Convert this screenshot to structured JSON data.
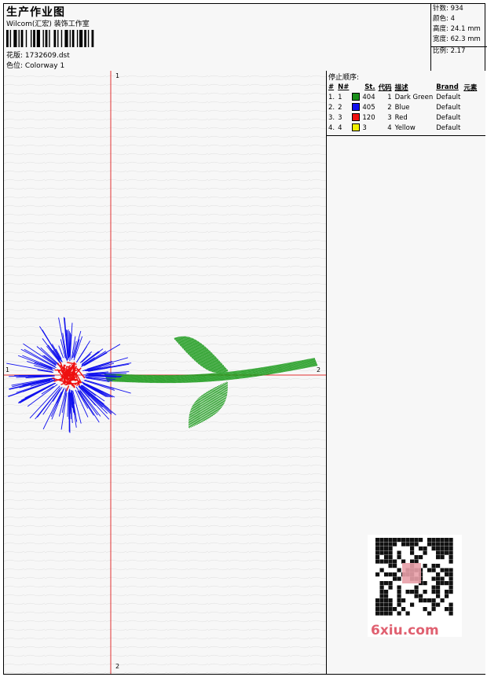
{
  "header": {
    "title": "生产作业图",
    "company": "Wilcom(汇宏) 装饰工作室",
    "design": "花版: 1732609.dst",
    "colorway": "色位: Colorway 1"
  },
  "stats": {
    "stitches": "针数: 934",
    "colors": "颜色: 4",
    "height": "高度: 24.1 mm",
    "width": "宽度: 62.3 mm",
    "scale": "比例: 2.17"
  },
  "legend": {
    "heading": "停止顺序:",
    "columns": [
      "#",
      "N#",
      "St.",
      "代码",
      "描述",
      "Brand",
      "元素"
    ],
    "rows": [
      {
        "idx": "1.",
        "n": "1",
        "color": "#1a8f1a",
        "st": "404",
        "code": "1",
        "desc": "Dark Green",
        "brand": "Default"
      },
      {
        "idx": "2.",
        "n": "2",
        "color": "#1010ee",
        "st": "405",
        "code": "2",
        "desc": "Blue",
        "brand": "Default"
      },
      {
        "idx": "3.",
        "n": "3",
        "color": "#ee1010",
        "st": "120",
        "code": "3",
        "desc": "Red",
        "brand": "Default"
      },
      {
        "idx": "4.",
        "n": "4",
        "color": "#f0f000",
        "st": "3",
        "code": "4",
        "desc": "Yellow",
        "brand": "Default"
      }
    ]
  },
  "axes": {
    "v_top": "1",
    "v_bottom": "2",
    "h_left": "1",
    "h_right": "2"
  },
  "colors": {
    "axis": "#e03030",
    "leaf": "#1a9a1a",
    "petal": "#1010ee",
    "center": "#ee1010"
  },
  "watermark": {
    "text": "6xiu.com"
  }
}
